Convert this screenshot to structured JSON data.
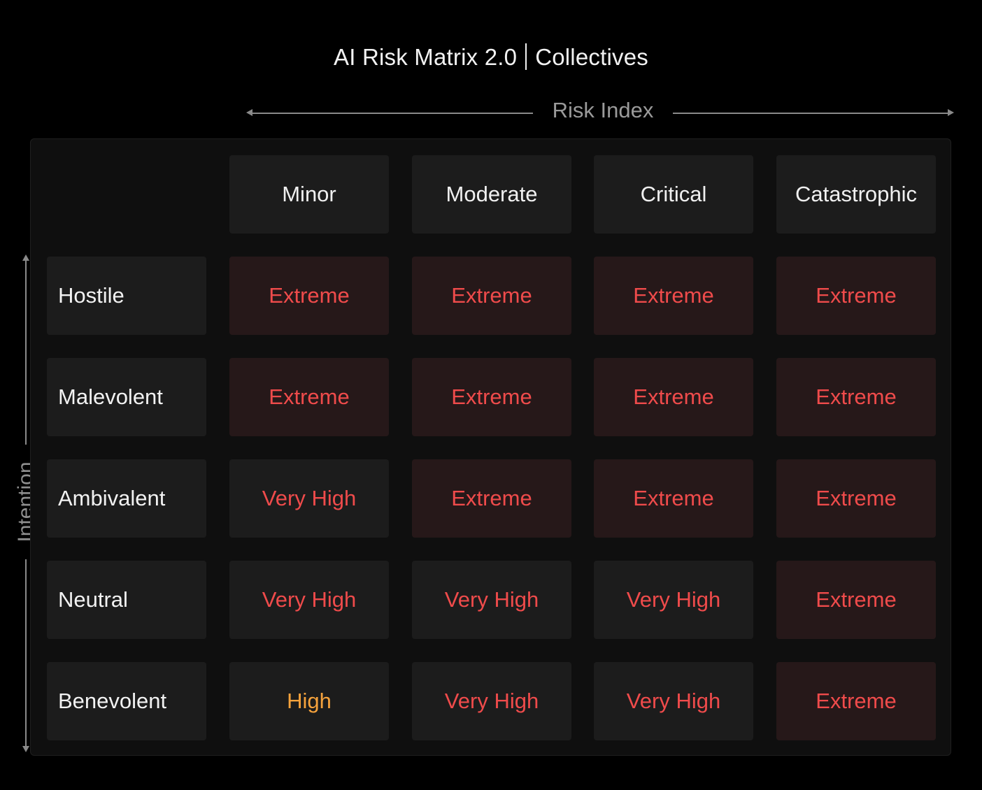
{
  "title": {
    "left": "AI Risk Matrix 2.0",
    "right": "Collectives"
  },
  "x_axis_label": "Risk Index",
  "y_axis_label": "Intention",
  "columns": [
    "Minor",
    "Moderate",
    "Critical",
    "Catastrophic"
  ],
  "rows": [
    {
      "label": "Hostile",
      "cells": [
        "Extreme",
        "Extreme",
        "Extreme",
        "Extreme"
      ]
    },
    {
      "label": "Malevolent",
      "cells": [
        "Extreme",
        "Extreme",
        "Extreme",
        "Extreme"
      ]
    },
    {
      "label": "Ambivalent",
      "cells": [
        "Very High",
        "Extreme",
        "Extreme",
        "Extreme"
      ]
    },
    {
      "label": "Neutral",
      "cells": [
        "Very High",
        "Very High",
        "Very High",
        "Extreme"
      ]
    },
    {
      "label": "Benevolent",
      "cells": [
        "High",
        "Very High",
        "Very High",
        "Extreme"
      ]
    }
  ],
  "colors": {
    "extreme_text": "#ef4b4b",
    "extreme_bg": "#261819",
    "very_high_text": "#ef4b4b",
    "high_text": "#f5a23c",
    "cell_bg": "#1c1c1c"
  }
}
